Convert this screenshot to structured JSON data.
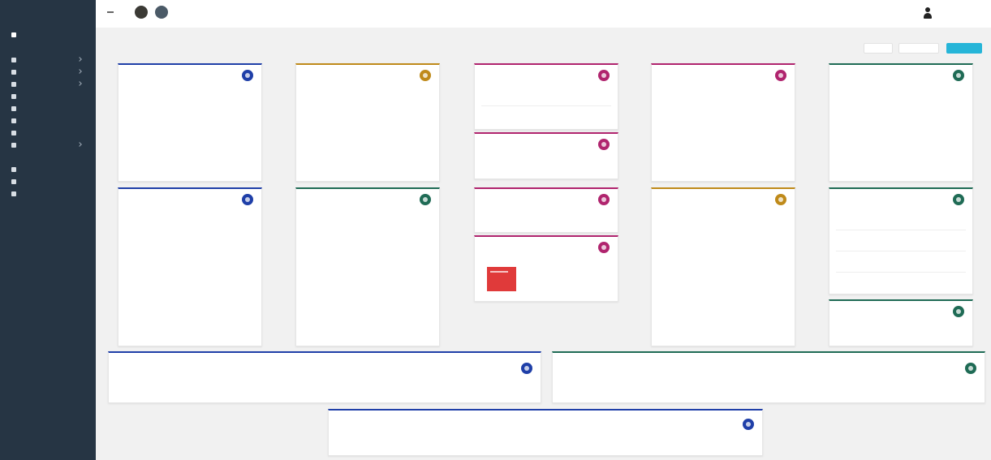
{
  "sidebar": {
    "top_item": {
      "label": ""
    },
    "section_label": "",
    "items": [
      {
        "label": ""
      },
      {
        "label": ""
      },
      {
        "label": ""
      },
      {
        "label": ""
      },
      {
        "label": ""
      },
      {
        "label": ""
      },
      {
        "label": ""
      },
      {
        "label": ""
      },
      {
        "label": ""
      }
    ],
    "section2_label": "",
    "items2": [
      {
        "label": ""
      },
      {
        "label": ""
      },
      {
        "label": ""
      }
    ],
    "extra1": "",
    "extra2": ""
  },
  "topbar": {
    "user_name": ""
  },
  "header": {
    "title": "",
    "subtitle": "",
    "btn1": "",
    "btn2": "",
    "btn3": ""
  },
  "colors": {
    "sidebar": "#263544",
    "accent": "#26b5d8",
    "navy": "#1f3fa8",
    "mustard": "#bf8a1a",
    "magenta": "#b0246e",
    "green": "#1f6b55",
    "red": "#e03a3a"
  },
  "icons": {
    "card1": "calendar-icon",
    "card2": "box-icon",
    "card3": "heart-icon",
    "card4": "shield-icon",
    "card5": "folder-icon",
    "card6": "people-icon",
    "card7": "cloud-icon",
    "card8": "star-icon",
    "card9": "chart-icon",
    "card10": "gear-icon",
    "card11": "heart-icon",
    "card12": "hand-icon",
    "card13": "eye-icon",
    "card14": "clock-icon",
    "card15": "chat-icon",
    "card16": "mail-icon"
  },
  "cards": {
    "c1": {
      "title": "",
      "value": ""
    },
    "c2": {
      "title": "",
      "value": ""
    },
    "c3": {
      "title": "",
      "value1": "",
      "value2": ""
    },
    "c4": {
      "title": "",
      "value": ""
    },
    "c5": {
      "title": "",
      "value": ""
    },
    "c6": {
      "title": "",
      "value": ""
    },
    "c7": {
      "title": "",
      "value": ""
    },
    "c8": {
      "title": "",
      "value": ""
    },
    "c9": {
      "title": "",
      "value": ""
    },
    "c10": {
      "title": "",
      "badge_text": ""
    },
    "c11": {
      "title": "",
      "value1": "",
      "value2": ""
    },
    "c12": {
      "title": "",
      "v1": "",
      "v2": "",
      "v3": "",
      "v4": ""
    },
    "c13": {
      "title": "",
      "value": ""
    },
    "c14": {
      "title": "",
      "value": ""
    },
    "c15": {
      "title": "",
      "value": ""
    },
    "c16": {
      "title": "",
      "value": ""
    }
  }
}
